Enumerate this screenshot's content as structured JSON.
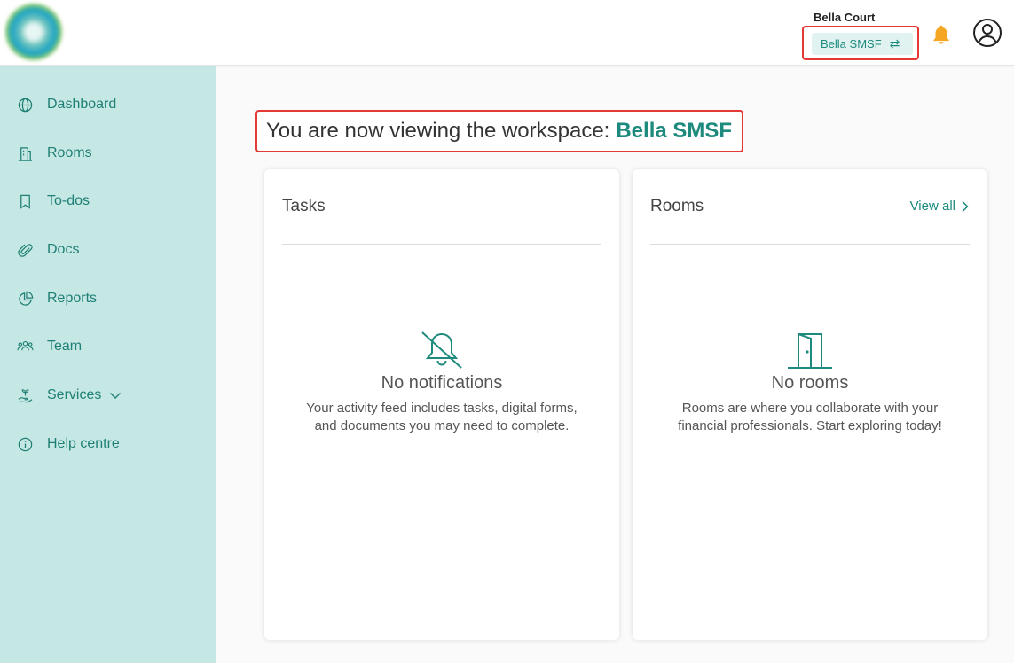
{
  "header": {
    "user_name": "Bella Court",
    "workspace_switch_label": "Bella SMSF",
    "workspace_switch_icon": "swap-icon",
    "notification_icon": "bell-icon",
    "account_icon": "user-circle-icon"
  },
  "sidebar": {
    "items": [
      {
        "label": "Dashboard",
        "icon": "globe-icon"
      },
      {
        "label": "Rooms",
        "icon": "building-icon"
      },
      {
        "label": "To-dos",
        "icon": "bookmark-icon"
      },
      {
        "label": "Docs",
        "icon": "paperclip-icon"
      },
      {
        "label": "Reports",
        "icon": "pie-chart-icon"
      },
      {
        "label": "Team",
        "icon": "team-icon"
      },
      {
        "label": "Services",
        "icon": "hand-plant-icon"
      },
      {
        "label": "Help centre",
        "icon": "info-icon"
      }
    ]
  },
  "main": {
    "heading_prefix": "You are now viewing the workspace:",
    "heading_workspace": "Bella SMSF",
    "tasks_card": {
      "title": "Tasks",
      "empty_title": "No notifications",
      "empty_text": "Your activity feed includes tasks, digital forms, and documents you may need to complete."
    },
    "rooms_card": {
      "title": "Rooms",
      "link": "View all",
      "empty_title": "No rooms",
      "empty_text": "Rooms are where you collaborate with your financial professionals. Start exploring today!"
    }
  },
  "colors": {
    "accent": "#1e8a7d",
    "sidebar_bg": "#c6e8e4",
    "bell": "#f5a623",
    "highlight": "#e53935"
  }
}
